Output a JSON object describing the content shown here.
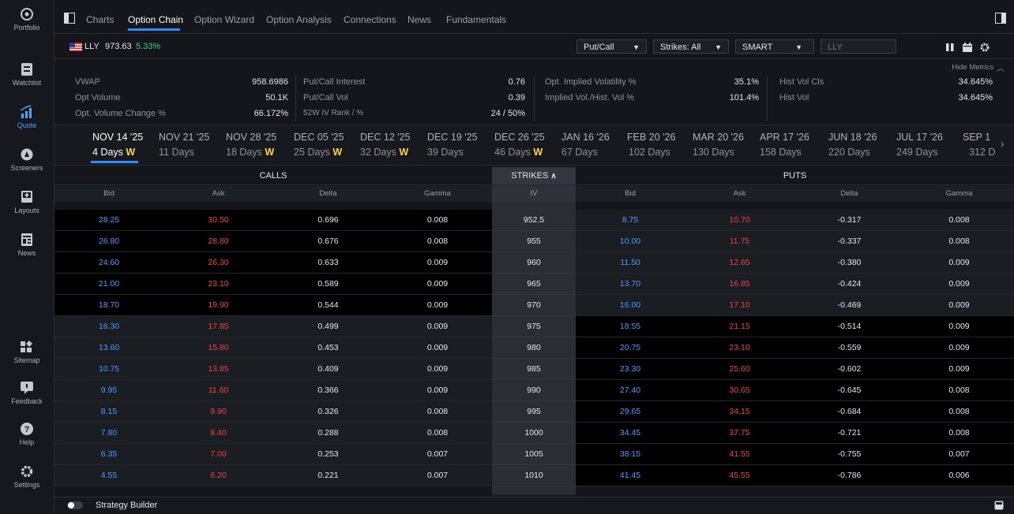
{
  "sidebar": {
    "items": [
      {
        "label": "Portfolio",
        "icon": "portfolio-icon"
      },
      {
        "label": "Watchlist",
        "icon": "watchlist-icon"
      },
      {
        "label": "Quote",
        "icon": "quote-icon",
        "active": true
      },
      {
        "label": "Screeners",
        "icon": "screeners-icon"
      },
      {
        "label": "Layouts",
        "icon": "layouts-icon"
      },
      {
        "label": "News",
        "icon": "news-icon"
      },
      {
        "label": "Sitemap",
        "icon": "sitemap-icon"
      },
      {
        "label": "Feedback",
        "icon": "feedback-icon"
      },
      {
        "label": "Help",
        "icon": "help-icon"
      },
      {
        "label": "Settings",
        "icon": "settings-icon"
      }
    ]
  },
  "tabs": [
    "Charts",
    "Option Chain",
    "Option Wizard",
    "Option Analysis",
    "Connections",
    "News",
    "Fundamentals"
  ],
  "active_tab": "Option Chain",
  "ticker": {
    "symbol": "LLY",
    "price": "973.63",
    "change": "5.33%"
  },
  "toolbar": {
    "putcall": "Put/Call",
    "strikes": "Strikes: All",
    "exchange": "SMART",
    "symbol_input": "LLY"
  },
  "metrics": {
    "hide_label": "Hide Metrics",
    "items": [
      {
        "label": "VWAP",
        "value": "958.6986"
      },
      {
        "label": "Opt Volume",
        "value": "50.1K"
      },
      {
        "label": "Opt. Volume Change %",
        "value": "66.172%"
      },
      {
        "label": "Put/Call Interest",
        "value": "0.76"
      },
      {
        "label": "Put/Call Vol",
        "value": "0.39"
      },
      {
        "label": "52W IV Rank / %",
        "value": "24 / 50%"
      },
      {
        "label": "Opt. Implied Volatility %",
        "value": "35.1%"
      },
      {
        "label": "Implied Vol./Hist. Vol %",
        "value": "101.4%"
      },
      {
        "label": "Hist Vol Cls",
        "value": "34.645%"
      },
      {
        "label": "Hist Vol",
        "value": "34.645%"
      }
    ]
  },
  "expirations": [
    {
      "date": "NOV 14 '25",
      "days": "4 Days",
      "w": true
    },
    {
      "date": "NOV 21 '25",
      "days": "11 Days",
      "w": false
    },
    {
      "date": "NOV 28 '25",
      "days": "18 Days",
      "w": true
    },
    {
      "date": "DEC 05 '25",
      "days": "25 Days",
      "w": true
    },
    {
      "date": "DEC 12 '25",
      "days": "32 Days",
      "w": true
    },
    {
      "date": "DEC 19 '25",
      "days": "39 Days",
      "w": false
    },
    {
      "date": "DEC 26 '25",
      "days": "46 Days",
      "w": true
    },
    {
      "date": "JAN 16 '26",
      "days": "67 Days",
      "w": false
    },
    {
      "date": "FEB 20 '26",
      "days": "102 Days",
      "w": false
    },
    {
      "date": "MAR 20 '26",
      "days": "130 Days",
      "w": false
    },
    {
      "date": "APR 17 '26",
      "days": "158 Days",
      "w": false
    },
    {
      "date": "JUN 18 '26",
      "days": "220 Days",
      "w": false
    },
    {
      "date": "JUL 17 '26",
      "days": "249 Days",
      "w": false
    },
    {
      "date": "SEP 1",
      "days": "312 D",
      "w": false
    }
  ],
  "weekly_marker": "W",
  "sections": {
    "calls": "CALLS",
    "strikes": "STRIKES",
    "puts": "PUTS"
  },
  "columns": {
    "calls": [
      "Bid",
      "Ask",
      "Delta",
      "Gamma"
    ],
    "center": "IV",
    "puts": [
      "Bid",
      "Ask",
      "Delta",
      "Gamma"
    ]
  },
  "rows": [
    {
      "cb": "28.25",
      "ca": "30.50",
      "cd": "0.696",
      "cg": "0.008",
      "k": "952.5",
      "pb": "8.75",
      "pa": "10.70",
      "pd": "-0.317",
      "pg": "0.008",
      "itm": true
    },
    {
      "cb": "26.80",
      "ca": "28.80",
      "cd": "0.676",
      "cg": "0.008",
      "k": "955",
      "pb": "10.00",
      "pa": "11.75",
      "pd": "-0.337",
      "pg": "0.008",
      "itm": true
    },
    {
      "cb": "24.60",
      "ca": "26.30",
      "cd": "0.633",
      "cg": "0.009",
      "k": "960",
      "pb": "11.50",
      "pa": "12.65",
      "pd": "-0.380",
      "pg": "0.009",
      "itm": true
    },
    {
      "cb": "21.00",
      "ca": "23.10",
      "cd": "0.589",
      "cg": "0.009",
      "k": "965",
      "pb": "13.70",
      "pa": "16.85",
      "pd": "-0.424",
      "pg": "0.009",
      "itm": true
    },
    {
      "cb": "18.70",
      "ca": "19.90",
      "cd": "0.544",
      "cg": "0.009",
      "k": "970",
      "pb": "16.00",
      "pa": "17.10",
      "pd": "-0.469",
      "pg": "0.009",
      "itm": true
    },
    {
      "cb": "16.30",
      "ca": "17.85",
      "cd": "0.499",
      "cg": "0.009",
      "k": "975",
      "pb": "18.55",
      "pa": "21.15",
      "pd": "-0.514",
      "pg": "0.009",
      "itm": false
    },
    {
      "cb": "13.60",
      "ca": "15.80",
      "cd": "0.453",
      "cg": "0.009",
      "k": "980",
      "pb": "20.75",
      "pa": "23.10",
      "pd": "-0.559",
      "pg": "0.009",
      "itm": false
    },
    {
      "cb": "10.75",
      "ca": "13.85",
      "cd": "0.409",
      "cg": "0.009",
      "k": "985",
      "pb": "23.30",
      "pa": "25.60",
      "pd": "-0.602",
      "pg": "0.009",
      "itm": false
    },
    {
      "cb": "9.95",
      "ca": "11.60",
      "cd": "0.366",
      "cg": "0.009",
      "k": "990",
      "pb": "27.40",
      "pa": "30.65",
      "pd": "-0.645",
      "pg": "0.008",
      "itm": false
    },
    {
      "cb": "8.15",
      "ca": "9.90",
      "cd": "0.326",
      "cg": "0.008",
      "k": "995",
      "pb": "29.65",
      "pa": "34.15",
      "pd": "-0.684",
      "pg": "0.008",
      "itm": false
    },
    {
      "cb": "7.80",
      "ca": "8.40",
      "cd": "0.288",
      "cg": "0.008",
      "k": "1000",
      "pb": "34.45",
      "pa": "37.75",
      "pd": "-0.721",
      "pg": "0.008",
      "itm": false
    },
    {
      "cb": "6.35",
      "ca": "7.00",
      "cd": "0.253",
      "cg": "0.007",
      "k": "1005",
      "pb": "38.15",
      "pa": "41.55",
      "pd": "-0.755",
      "pg": "0.007",
      "itm": false
    },
    {
      "cb": "4.55",
      "ca": "6.20",
      "cd": "0.221",
      "cg": "0.007",
      "k": "1010",
      "pb": "41.45",
      "pa": "45.55",
      "pd": "-0.786",
      "pg": "0.006",
      "itm": false
    }
  ],
  "bottom": {
    "strategy_builder": "Strategy Builder"
  },
  "colors": {
    "accent": "#2f8cff",
    "bid": "#4a9dff",
    "ask": "#f0434b",
    "gain": "#3ecf8e",
    "weekly": "#ffd34d",
    "itm_bg": "#000000",
    "otm_bg": "#1a1d22"
  }
}
